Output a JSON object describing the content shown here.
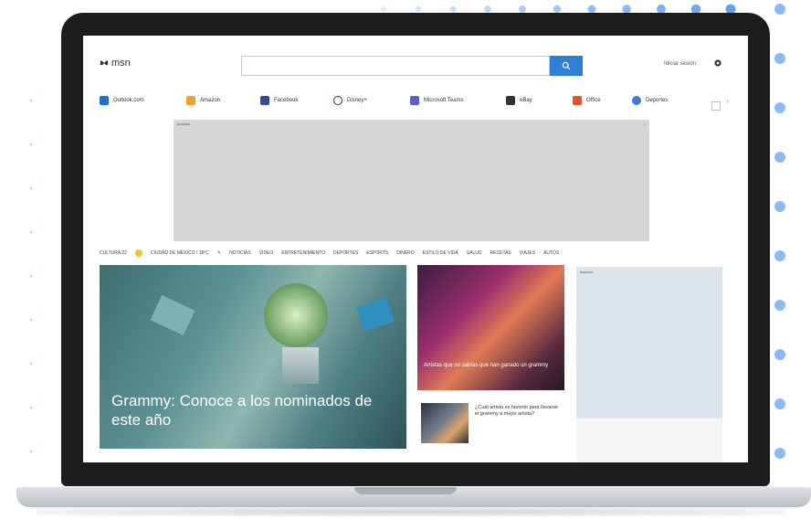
{
  "app": {
    "logo_text": "msn"
  },
  "header": {
    "search_placeholder": "",
    "signin_label": "Iniciar sesión"
  },
  "shortcuts": [
    {
      "label": "Outlook.com",
      "sub": "",
      "color": "#1f6fd1"
    },
    {
      "label": "Amazon",
      "sub": "",
      "color": "#f0a030"
    },
    {
      "label": "Facebook",
      "sub": "",
      "color": "#2d4f9a"
    },
    {
      "label": "Disney+",
      "sub": "",
      "color": "#1a3a7a"
    },
    {
      "label": "Microsoft Teams",
      "sub": "",
      "color": "#5b5fc7"
    },
    {
      "label": "eBay",
      "sub": "",
      "color": "#333333"
    },
    {
      "label": "Office",
      "sub": "",
      "color": "#e0522a"
    },
    {
      "label": "Deportes",
      "sub": "",
      "color": "#3b7bd4"
    }
  ],
  "ad": {
    "label": "Anuncio",
    "close": "×"
  },
  "nav": {
    "weather": "CULTURA 22",
    "location": "CIUDAD DE MÉXICO / 18°C",
    "items": [
      "NOTICIAS",
      "VIDEO",
      "ENTRETENIMIENTO",
      "DEPORTES",
      "ESPORTS",
      "DINERO",
      "ESTILO DE VIDA",
      "SALUD",
      "RECETAS",
      "VIAJES",
      "AUTOS"
    ]
  },
  "hero": {
    "title": "Grammy: Conoce a los nominados de este año"
  },
  "card2": {
    "title": "Artistas que no sabías que han ganado un grammy"
  },
  "card3": {
    "title": "¿Cuál artista es favorito para llevarse el grammy a mejor artista?"
  },
  "side": {
    "label": "Anuncio"
  },
  "colors": {
    "accent": "#2f7fd9",
    "laptop": "#1b1c1e",
    "dots": "#2f80ed"
  }
}
